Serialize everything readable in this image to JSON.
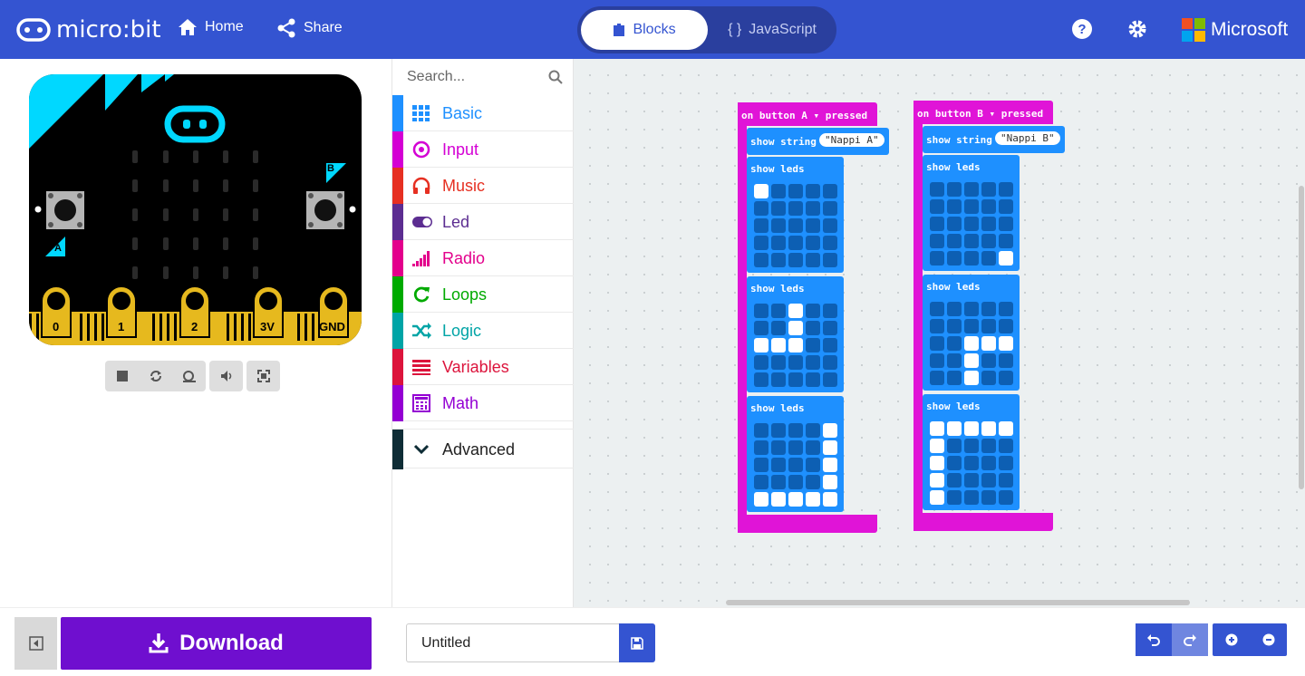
{
  "header": {
    "brand": "micro:bit",
    "home_label": "Home",
    "share_label": "Share",
    "tab_blocks": "Blocks",
    "tab_javascript": "JavaScript",
    "ms_label": "Microsoft"
  },
  "simulator": {
    "pins": [
      "0",
      "1",
      "2",
      "3V",
      "GND"
    ],
    "button_a": "A",
    "button_b": "B"
  },
  "toolbox": {
    "search_placeholder": "Search...",
    "categories": [
      {
        "label": "Basic",
        "color": "#1e90ff",
        "icon": "grid-icon"
      },
      {
        "label": "Input",
        "color": "#d400d4",
        "icon": "target-icon"
      },
      {
        "label": "Music",
        "color": "#e63022",
        "icon": "headphones-icon"
      },
      {
        "label": "Led",
        "color": "#5c2d91",
        "icon": "toggle-icon"
      },
      {
        "label": "Radio",
        "color": "#e3008c",
        "icon": "signal-icon"
      },
      {
        "label": "Loops",
        "color": "#00aa00",
        "icon": "loop-icon"
      },
      {
        "label": "Logic",
        "color": "#00a4a6",
        "icon": "shuffle-icon"
      },
      {
        "label": "Variables",
        "color": "#dc143c",
        "icon": "lines-icon"
      },
      {
        "label": "Math",
        "color": "#9400d3",
        "icon": "calculator-icon"
      }
    ],
    "advanced_label": "Advanced",
    "advanced_color": "#0f2d36"
  },
  "workspace": {
    "handlers": [
      {
        "event_prefix": "on button",
        "button": "A",
        "event_suffix": "pressed",
        "show_string_label": "show string",
        "string_value": "\"Nappi A\"",
        "show_leds_label": "show leds",
        "leds": [
          [
            1,
            0,
            0,
            0,
            0,
            0,
            0,
            0,
            0,
            0,
            0,
            0,
            0,
            0,
            0,
            0,
            0,
            0,
            0,
            0,
            0,
            0,
            0,
            0,
            0
          ],
          [
            0,
            0,
            1,
            0,
            0,
            0,
            0,
            1,
            0,
            0,
            1,
            1,
            1,
            0,
            0,
            0,
            0,
            0,
            0,
            0,
            0,
            0,
            0,
            0,
            0
          ],
          [
            0,
            0,
            0,
            0,
            1,
            0,
            0,
            0,
            0,
            1,
            0,
            0,
            0,
            0,
            1,
            0,
            0,
            0,
            0,
            1,
            1,
            1,
            1,
            1,
            1
          ]
        ]
      },
      {
        "event_prefix": "on button",
        "button": "B",
        "event_suffix": "pressed",
        "show_string_label": "show string",
        "string_value": "\"Nappi B\"",
        "show_leds_label": "show leds",
        "leds": [
          [
            0,
            0,
            0,
            0,
            0,
            0,
            0,
            0,
            0,
            0,
            0,
            0,
            0,
            0,
            0,
            0,
            0,
            0,
            0,
            0,
            0,
            0,
            0,
            0,
            1
          ],
          [
            0,
            0,
            0,
            0,
            0,
            0,
            0,
            0,
            0,
            0,
            0,
            0,
            1,
            1,
            1,
            0,
            0,
            1,
            0,
            0,
            0,
            0,
            1,
            0,
            0
          ],
          [
            1,
            1,
            1,
            1,
            1,
            1,
            0,
            0,
            0,
            0,
            1,
            0,
            0,
            0,
            0,
            1,
            0,
            0,
            0,
            0,
            1,
            0,
            0,
            0,
            0
          ]
        ]
      }
    ]
  },
  "footer": {
    "download_label": "Download",
    "project_name": "Untitled"
  },
  "colors": {
    "header": "#3454D1",
    "download": "#6f0fcf",
    "event_block": "#e014d7",
    "basic_block": "#1e90ff"
  }
}
